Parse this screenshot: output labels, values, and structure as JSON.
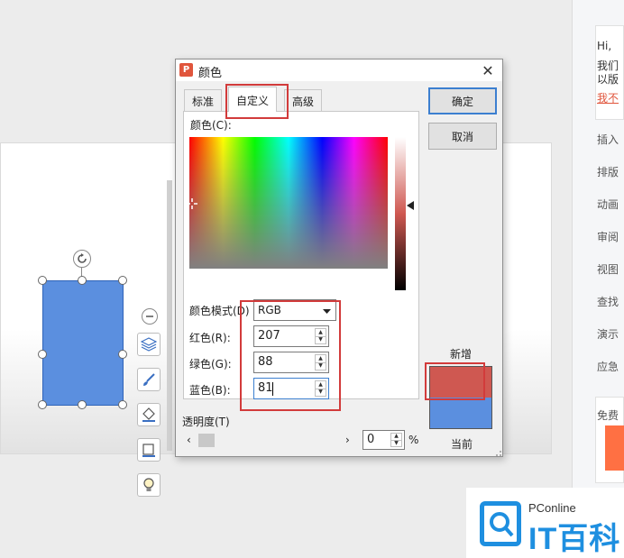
{
  "dialog": {
    "title": "颜色",
    "app_icon_glyph": "P",
    "tabs": [
      {
        "label": "标准"
      },
      {
        "label": "自定义"
      },
      {
        "label": "高级"
      }
    ],
    "color_label": "颜色(C):",
    "mode_label": "颜色模式(D)",
    "mode_value": "RGB",
    "red_label": "红色(R):",
    "red_value": "207",
    "green_label": "绿色(G):",
    "green_value": "88",
    "blue_label": "蓝色(B):",
    "blue_value": "81",
    "transparency_label": "透明度(T)",
    "transparency_value": "0",
    "percent": "%",
    "ok_label": "确定",
    "cancel_label": "取消",
    "new_label": "新增",
    "current_label": "当前",
    "new_color": "#cf5851",
    "current_color": "#5b8fdf"
  },
  "side_panel": {
    "chat_lines": [
      "Hi,",
      "我们",
      "以版",
      "我不"
    ],
    "items": [
      "插入",
      "排版",
      "动画",
      "审阅",
      "视图",
      "查找",
      "演示",
      "应急"
    ],
    "promo": "免费"
  },
  "watermark": {
    "sub": "PConline",
    "main": "IT百科"
  },
  "colors": {
    "accent": "#3c7fd0",
    "highlight": "#d23b3b",
    "shape_fill": "#5b8fdf"
  }
}
